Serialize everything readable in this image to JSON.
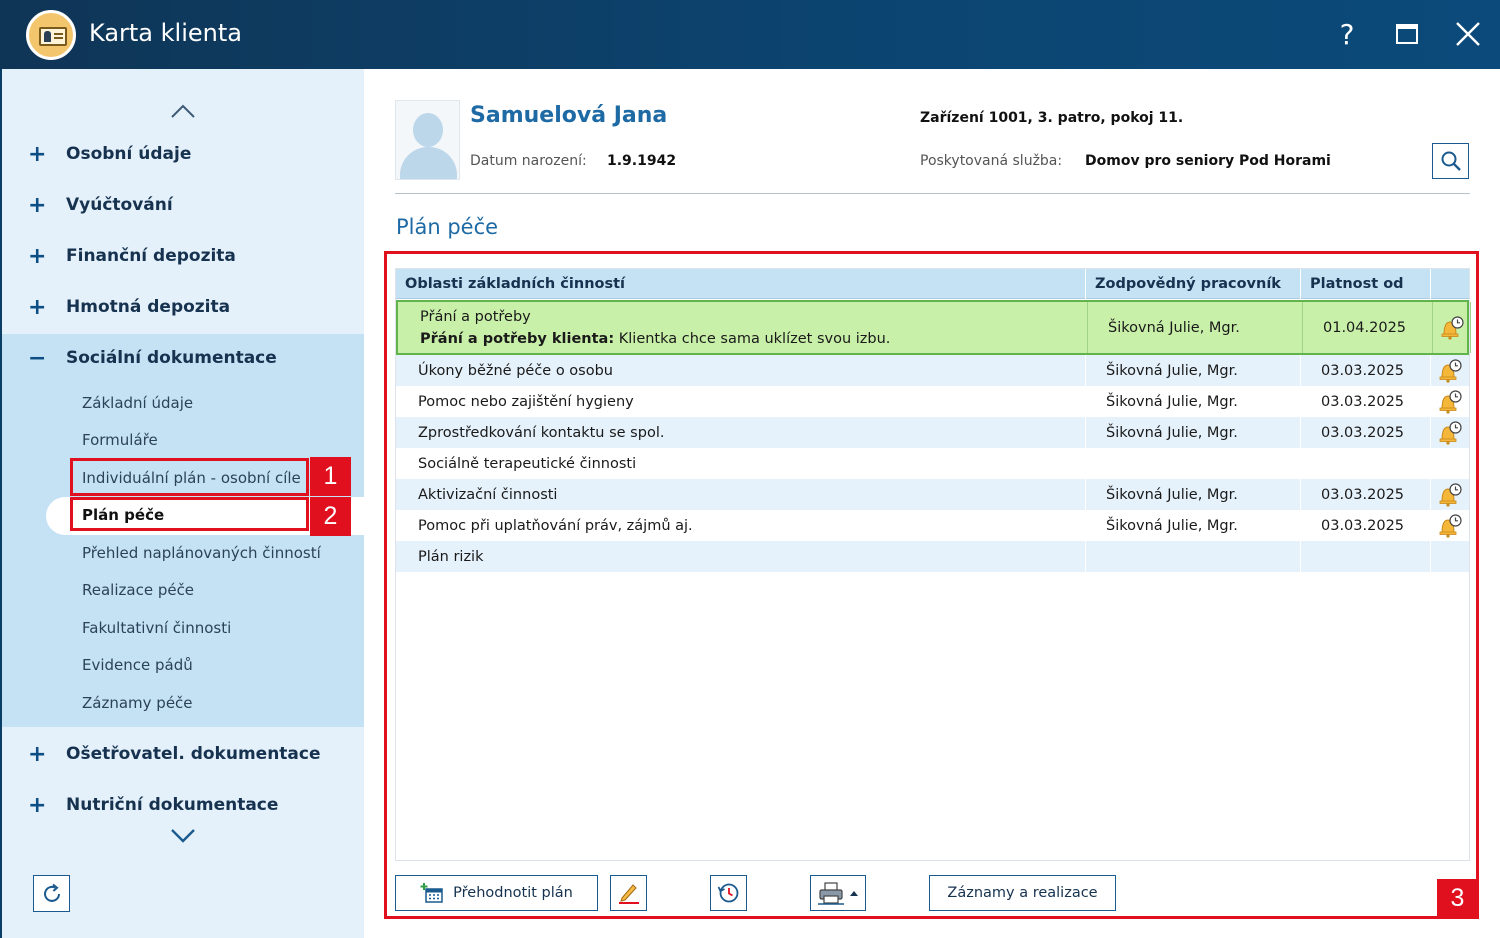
{
  "window": {
    "title": "Karta klienta",
    "help_label": "?"
  },
  "sidebar": {
    "groups": [
      {
        "sign": "+",
        "label": "Osobní údaje"
      },
      {
        "sign": "+",
        "label": "Vyúčtování"
      },
      {
        "sign": "+",
        "label": "Finanční depozita"
      },
      {
        "sign": "+",
        "label": "Hmotná depozita"
      },
      {
        "sign": "−",
        "label": "Sociální dokumentace"
      },
      {
        "sign": "+",
        "label": "Ošetřovatel. dokumentace"
      },
      {
        "sign": "+",
        "label": "Nutriční dokumentace"
      }
    ],
    "subitems": [
      "Základní údaje",
      "Formuláře",
      "Individuální plán - osobní cíle",
      "Plán péče",
      "Přehled naplánovaných činností",
      "Realizace péče",
      "Fakultativní činnosti",
      "Evidence pádů",
      "Záznamy péče"
    ],
    "active_subitem": "Plán péče"
  },
  "client": {
    "name": "Samuelová Jana",
    "dob_label": "Datum narození:",
    "dob": "1.9.1942",
    "location": "Zařízení 1001, 3. patro, pokoj 11.",
    "service_label": "Poskytovaná služba:",
    "service": "Domov pro seniory Pod Horami"
  },
  "section_title": "Plán péče",
  "table": {
    "headers": [
      "Oblasti základních činností",
      "Zodpovědný pracovník",
      "Platnost od"
    ],
    "rows": [
      {
        "area": "Přání a potřeby",
        "detail_label": "Přání a potřeby klienta:",
        "detail_text": " Klientka chce sama uklízet svou izbu.",
        "responsible": "Šikovná Julie, Mgr.",
        "valid_from": "01.04.2025",
        "icon": "bell-clock-icon"
      },
      {
        "area": "Úkony běžné péče o osobu",
        "responsible": "Šikovná Julie, Mgr.",
        "valid_from": "03.03.2025",
        "icon": "bell-clock-icon"
      },
      {
        "area": "Pomoc nebo zajištění hygieny",
        "responsible": "Šikovná Julie, Mgr.",
        "valid_from": "03.03.2025",
        "icon": "bell-clock-icon"
      },
      {
        "area": "Zprostředkování kontaktu se spol.",
        "responsible": "Šikovná Julie, Mgr.",
        "valid_from": "03.03.2025",
        "icon": "bell-clock-icon"
      },
      {
        "area": "Sociálně terapeutické činnosti",
        "responsible": "",
        "valid_from": "",
        "icon": ""
      },
      {
        "area": "Aktivizační činnosti",
        "responsible": "Šikovná Julie, Mgr.",
        "valid_from": "03.03.2025",
        "icon": "bell-clock-icon"
      },
      {
        "area": "Pomoc při uplatňování práv, zájmů aj.",
        "responsible": "Šikovná Julie, Mgr.",
        "valid_from": "03.03.2025",
        "icon": "bell-clock-icon"
      },
      {
        "area": "Plán rizik",
        "responsible": "",
        "valid_from": "",
        "icon": ""
      }
    ]
  },
  "toolbar": {
    "reevaluate_label": "Přehodnotit plán",
    "records_label": "Záznamy a realizace"
  },
  "annotations": [
    "1",
    "2",
    "3"
  ],
  "colors": {
    "titlebar": "#0c4470",
    "sidebar": "#e4f1fb",
    "accent_blue": "#1d6aa5",
    "selected_row": "#c9f0a9",
    "annotation_red": "#e0101e"
  }
}
